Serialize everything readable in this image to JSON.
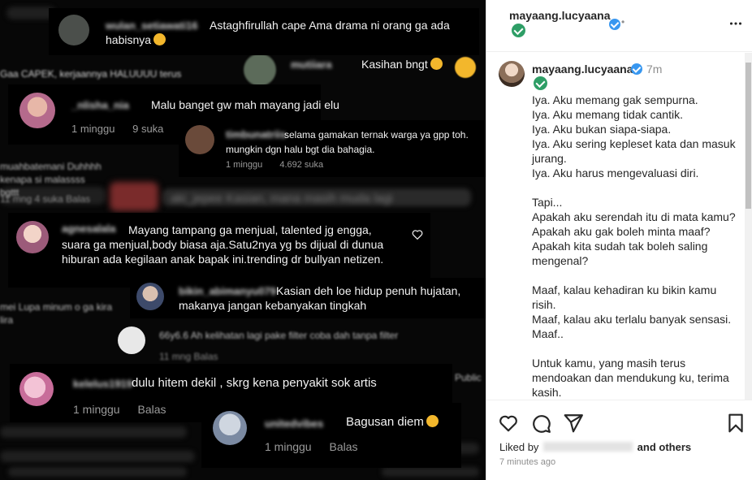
{
  "header": {
    "username": "mayaang.lucyaana",
    "dot": "•",
    "more_icon": "more-horizontal-icon"
  },
  "caption": {
    "username": "mayaang.lucyaana",
    "time": "7m",
    "lines": [
      "Iya. Aku memang gak sempurna.",
      "Iya. Aku memang tidak cantik.",
      "Iya. Aku bukan siapa-siapa.",
      "Iya. Aku sering kepleset kata dan masuk jurang.",
      "Iya. Aku harus mengevaluasi diri.",
      "",
      "Tapi...",
      "Apakah aku serendah itu di mata kamu?",
      "Apakah aku gak boleh minta maaf?",
      "Apakah kita sudah tak boleh saling mengenal?",
      "",
      "Maaf, kalau kehadiran ku bikin kamu risih.",
      "Maaf, kalau aku terlalu banyak sensasi.",
      "Maaf..",
      "",
      "Untuk kamu, yang masih terus mendoakan dan mendukung ku, terima kasih."
    ]
  },
  "actions": {
    "liked_by_prefix": "Liked by",
    "liked_by_suffix": "and others",
    "time_ago": "7 minutes ago"
  },
  "comments": [
    {
      "user": "wulan_setiawati16",
      "text": "Astaghfirullah cape Ama drama ni orang ga ada habisnya"
    },
    {
      "user": "mutiiara",
      "text": "Kasihan bngt"
    },
    {
      "user": "_nlisha_nia",
      "text": "Malu banget gw mah mayang jadi elu",
      "time": "1 minggu",
      "likes": "9 suka"
    },
    {
      "user": "timbunatriis",
      "text": "selama gamakan ternak warga ya gpp toh. mungkin dgn halu bgt dia bahagia.",
      "time": "1 minggu",
      "likes": "4.692 suka"
    },
    {
      "user": "agnesalala",
      "text": "Mayang tampang ga menjual, talented jg engga, suara ga menjual,body biasa aja.Satu2nya yg bs dijual di dunua hiburan ada kegilaan anak bapak ini.trending dr bullyan netizen."
    },
    {
      "user": "bikin_abimanyu079",
      "text": "Kasian deh loe hidup penuh hujatan, makanya jangan kebanyakan tingkah"
    },
    {
      "user": "kelelus1919",
      "text": "dulu hitem dekil , skrg kena penyakit sok artis",
      "time": "1 minggu",
      "reply": "Balas"
    },
    {
      "user": "unitedvibes",
      "text": "Bagusan diem",
      "time": "1 minggu",
      "reply": "Balas"
    }
  ],
  "background_fragments": [
    "Gaa CAPEK, kerjaannya HALUUUU terus",
    "muahbatemani Duhhhh kenapa si malassss bgttt",
    "11 mng  4 suka  Balas",
    "aki_jepee Kasian, mana masih muda lagi",
    "mei Lupa minum o ga kira lira",
    "66y6.6 Ah kelihatan lagi pake filter coba dah tanpa filter",
    "11 mng  Balas",
    "1 minggu  4.692 suka",
    "Public"
  ]
}
